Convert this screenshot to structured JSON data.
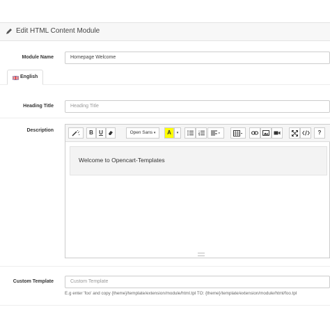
{
  "header": {
    "title": "Edit HTML Content Module",
    "icon": "pencil-icon"
  },
  "module_name": {
    "label": "Module Name",
    "value": "Homepage Welcome"
  },
  "language_tab": {
    "label": "English",
    "icon": "uk-flag-icon"
  },
  "heading_title": {
    "label": "Heading Title",
    "placeholder": "Heading Title"
  },
  "description": {
    "label": "Description",
    "toolbar": {
      "bold": "B",
      "underline": "U",
      "font_family": "Open Sans",
      "font_color": "A",
      "help": "?"
    },
    "content": "Welcome to Opencart-Templates"
  },
  "custom_template": {
    "label": "Custom Template",
    "placeholder": "Custom Template",
    "help": "E.g enter 'foo' and copy {theme}/template/extension/module/html.tpl TO: {theme}/template/extension/module/html/foo.tpl"
  }
}
